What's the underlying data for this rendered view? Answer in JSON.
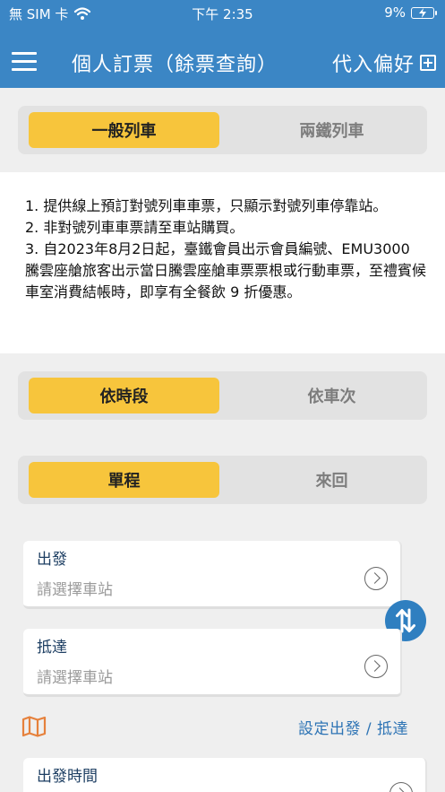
{
  "status_bar": {
    "carrier": "無 SIM 卡",
    "time": "下午 2:35",
    "battery": "9%"
  },
  "nav": {
    "title": "個人訂票（餘票查詢）",
    "action_label": "代入偏好"
  },
  "train_type": {
    "options": [
      "一般列車",
      "兩鐵列車"
    ],
    "selected": "一般列車"
  },
  "notice": {
    "lines": [
      "1. 提供線上預訂對號列車車票，只顯示對號列車停靠站。",
      "2. 非對號列車車票請至車站購買。",
      "3. 自2023年8月2日起，臺鐵會員出示會員編號、EMU3000 騰雲座艙旅客出示當日騰雲座艙車票票根或行動車票，至禮賓候車室消費結帳時，即享有全餐飲 9 折優惠。"
    ]
  },
  "search_mode": {
    "options": [
      "依時段",
      "依車次"
    ],
    "selected": "依時段"
  },
  "trip_type": {
    "options": [
      "單程",
      "來回"
    ],
    "selected": "單程"
  },
  "departure": {
    "label": "出發",
    "placeholder": "請選擇車站"
  },
  "arrival": {
    "label": "抵達",
    "placeholder": "請選擇車站"
  },
  "set_link": "設定出發 / 抵達",
  "departure_time": {
    "label": "出發時間"
  },
  "colors": {
    "header": "#3b86c5",
    "accent": "#f7c53c",
    "link": "#2e74b5",
    "map_icon": "#e6813c"
  },
  "icons": {
    "menu": "hamburger-icon",
    "add": "plus-box-icon",
    "swap": "swap-arrows-icon",
    "map": "map-icon",
    "chevron": "chevron-right-circle-icon"
  }
}
